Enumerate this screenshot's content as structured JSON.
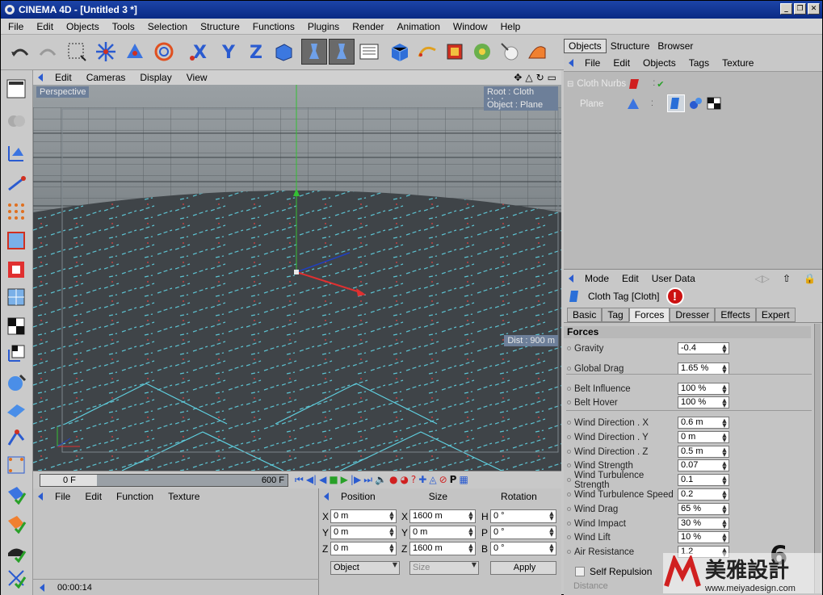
{
  "window": {
    "title": "CINEMA 4D - [Untitled 3 *]",
    "buttons": [
      "_",
      "❐",
      "✕"
    ]
  },
  "menubar": [
    "File",
    "Edit",
    "Objects",
    "Tools",
    "Selection",
    "Structure",
    "Functions",
    "Plugins",
    "Render",
    "Animation",
    "Window",
    "Help"
  ],
  "viewport": {
    "menu": [
      "Edit",
      "Cameras",
      "Display",
      "View"
    ],
    "camera_label": "Perspective",
    "root_label": "Root : Cloth Nurbs",
    "object_label": "Object : Plane",
    "dist_label": "Dist : 900 m"
  },
  "timeline": {
    "start": "0 F",
    "end": "600 F",
    "progress": 0.0
  },
  "material_panel": {
    "menu": [
      "File",
      "Edit",
      "Function",
      "Texture"
    ],
    "time": "00:00:14"
  },
  "coord_panel": {
    "headers": [
      "Position",
      "Size",
      "Rotation"
    ],
    "position": {
      "X": "0 m",
      "Y": "0 m",
      "Z": "0 m"
    },
    "size": {
      "X": "1600 m",
      "Y": "0 m",
      "Z": "1600 m"
    },
    "rotation": {
      "H": "0 °",
      "P": "0 °",
      "B": "0 °"
    },
    "mode_select": "Object",
    "size_select": "Size",
    "apply_label": "Apply"
  },
  "objects": {
    "tabs": [
      "Objects",
      "Structure",
      "Browser"
    ],
    "menu": [
      "File",
      "Edit",
      "Objects",
      "Tags",
      "Texture"
    ],
    "items": [
      "Cloth Nurbs",
      "Plane"
    ]
  },
  "attributes": {
    "menu": [
      "Mode",
      "Edit",
      "User Data"
    ],
    "title": "Cloth Tag [Cloth]",
    "tabs": [
      "Basic",
      "Tag",
      "Forces",
      "Dresser",
      "Effects",
      "Expert"
    ],
    "active_tab": "Forces",
    "section": "Forces",
    "rows": [
      {
        "label": "Gravity",
        "value": "-0.4"
      },
      {
        "label": "Global Drag",
        "value": "1.65 %"
      },
      {
        "label": "Belt Influence",
        "value": "100 %"
      },
      {
        "label": "Belt Hover",
        "value": "100 %"
      },
      {
        "label": "Wind Direction . X",
        "value": "0.6 m"
      },
      {
        "label": "Wind Direction . Y",
        "value": "0 m"
      },
      {
        "label": "Wind Direction . Z",
        "value": "0.5 m"
      },
      {
        "label": "Wind Strength",
        "value": "0.07"
      },
      {
        "label": "Wind Turbulence Strength",
        "value": "0.1"
      },
      {
        "label": "Wind Turbulence Speed",
        "value": "0.2"
      },
      {
        "label": "Wind Drag",
        "value": "65 %"
      },
      {
        "label": "Wind Impact",
        "value": "30 %"
      },
      {
        "label": "Wind Lift",
        "value": "10 %"
      },
      {
        "label": "Air Resistance",
        "value": "1.2"
      }
    ],
    "self_repulsion": "Self Repulsion",
    "distance": "Distance"
  },
  "overlay": {
    "step": "6",
    "watermark": "美雅設計",
    "watermark_url": "www.meiyadesign.com"
  },
  "colors": {
    "title_bar": "#0a2a84",
    "viewport_bg": "#3f4448",
    "grid_line": "#5fd0e0",
    "alert": "#cc1111"
  }
}
